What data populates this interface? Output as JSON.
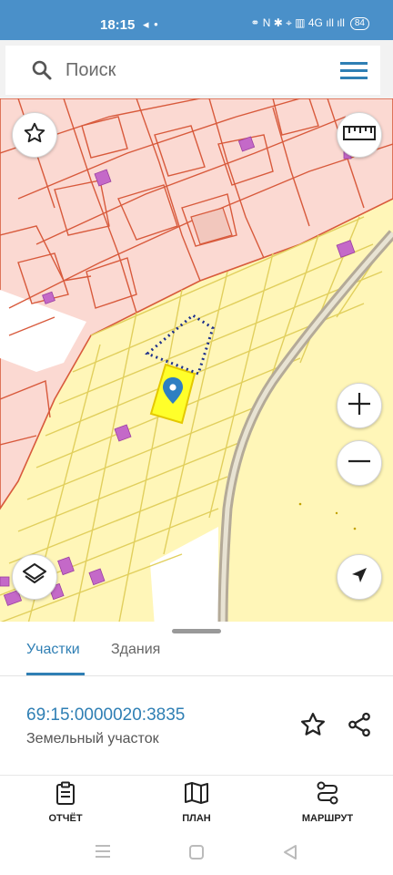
{
  "status_bar": {
    "time": "18:15",
    "left_icons": "◂ •",
    "right_icons": "⚭ N ✱ ⌖ ▥ 4G ıll ıll",
    "battery": "84"
  },
  "search": {
    "placeholder": "Поиск"
  },
  "tabs": [
    {
      "label": "Участки",
      "active": true
    },
    {
      "label": "Здания",
      "active": false
    }
  ],
  "parcel": {
    "number": "69:15:0000020:3835",
    "type": "Земельный участок"
  },
  "actions": {
    "report_label": "ОТЧЁТ",
    "plan_label": "ПЛАН",
    "route_label": "МАРШРУТ"
  },
  "icons": {
    "search": "search-icon",
    "menu": "hamburger-menu-icon",
    "favorite": "star-icon",
    "ruler": "ruler-icon",
    "zoom_in": "plus-icon",
    "zoom_out": "minus-icon",
    "layers": "layers-icon",
    "locate": "navigation-arrow-icon",
    "share": "share-icon",
    "report": "clipboard-icon",
    "plan": "map-icon",
    "route": "route-icon"
  },
  "colors": {
    "accent": "#2f7fb4",
    "status_bar": "#4a90c9",
    "parcel_fill": "#fff6b8",
    "parcel_line": "#e1cf5d",
    "urban_fill": "#fbd9d2",
    "urban_line": "#d85a3c",
    "building": "#c469c8",
    "selected": "#ffff2a",
    "road": "#b4aa98"
  }
}
